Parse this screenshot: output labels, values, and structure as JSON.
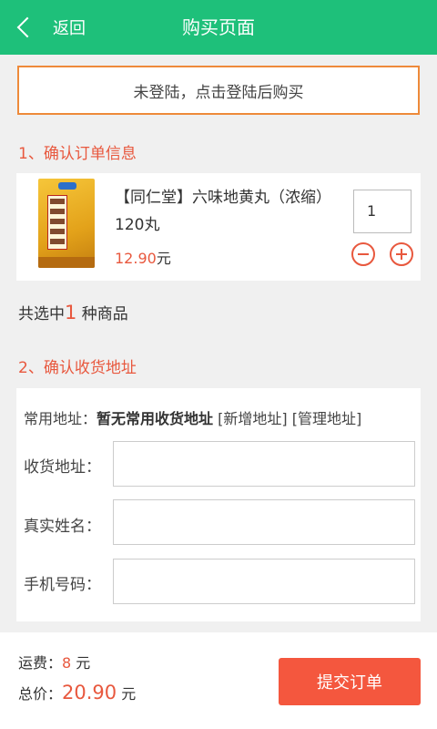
{
  "header": {
    "back_label": "返回",
    "title": "购买页面"
  },
  "login_banner": "未登陆，点击登陆后购买",
  "sections": {
    "order_title": "1、确认订单信息",
    "address_title": "2、确认收货地址"
  },
  "product": {
    "name": "【同仁堂】六味地黄丸（浓缩）120丸",
    "price": "12.90",
    "price_unit": "元",
    "quantity": "1"
  },
  "selection": {
    "prefix": "共选中",
    "count": "1",
    "suffix": " 种商品"
  },
  "address": {
    "common_label": "常用地址：",
    "common_value": "暂无常用收货地址",
    "add_link": "[新增地址]",
    "manage_link": "[管理地址]",
    "fields": {
      "address_label": "收货地址：",
      "name_label": "真实姓名：",
      "phone_label": "手机号码："
    }
  },
  "footer": {
    "shipping_label": "运费：",
    "shipping_value": "8",
    "shipping_unit": " 元",
    "total_label": "总价：",
    "total_value": "20.90",
    "total_unit": " 元",
    "submit_label": "提交订单"
  },
  "colors": {
    "header": "#1ec07a",
    "accent": "#e8583e",
    "banner_border": "#ee8a3a",
    "submit": "#f4573e"
  }
}
